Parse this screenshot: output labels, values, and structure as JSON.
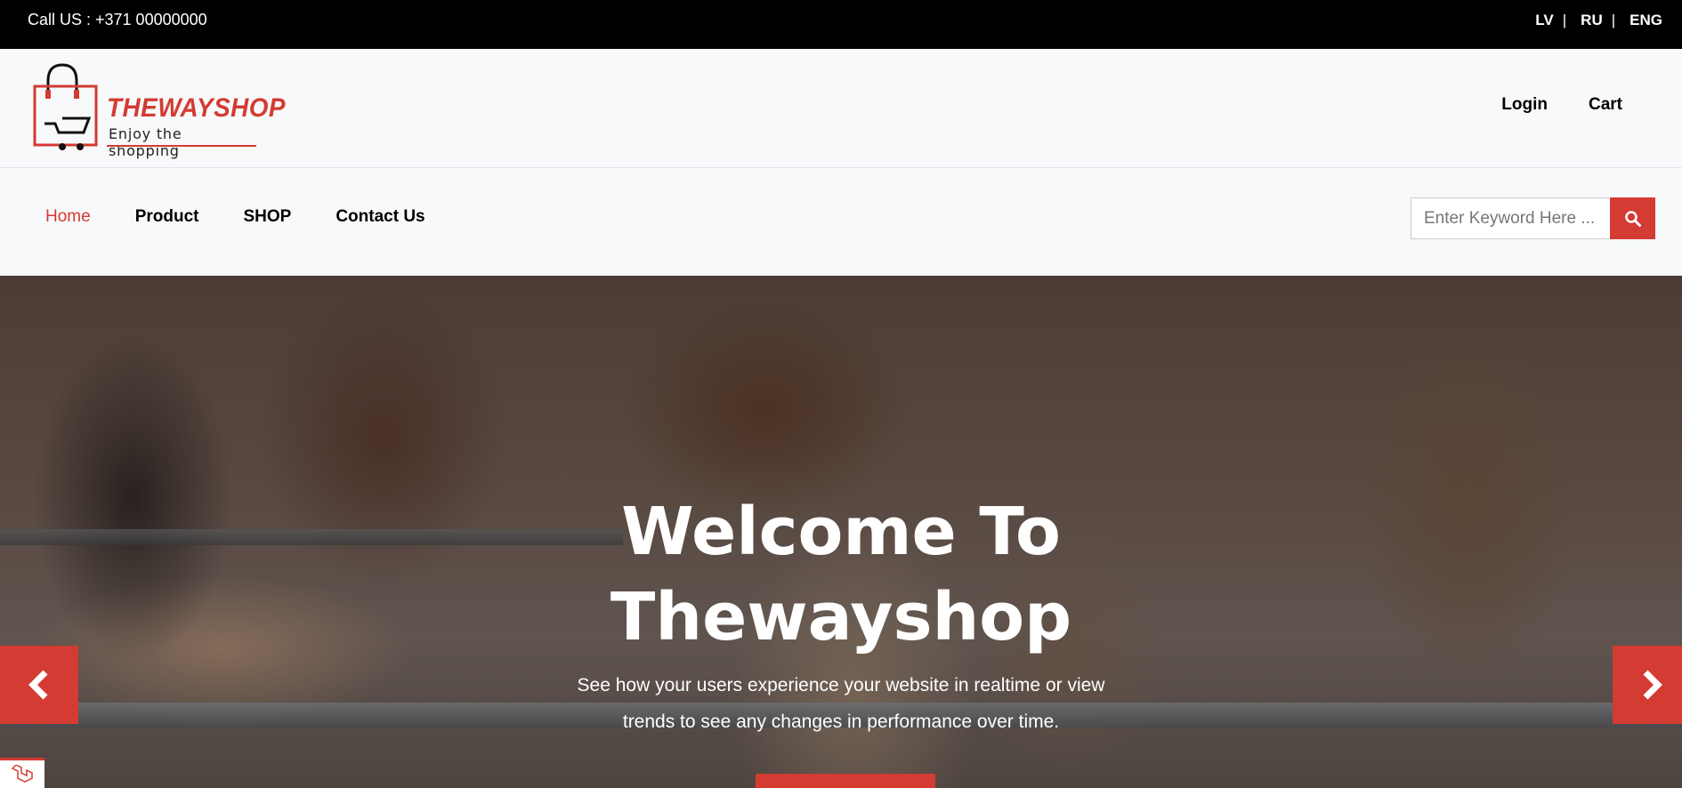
{
  "topbar": {
    "call_text": "Call US : +371 00000000",
    "languages": [
      "LV",
      "RU",
      "ENG"
    ],
    "separator": "|"
  },
  "brand": {
    "name": "THEWAYSHOP",
    "tagline": "Enjoy the shopping",
    "accent_color": "#d33b33"
  },
  "header": {
    "links": [
      "Login",
      "Cart"
    ]
  },
  "nav": {
    "items": [
      "Home",
      "Product",
      "SHOP",
      "Contact Us"
    ],
    "active": "Home"
  },
  "search": {
    "placeholder": "Enter Keyword Here ...",
    "icon": "search-icon"
  },
  "hero": {
    "title_line1": "Welcome To",
    "title_line2": "Thewayshop",
    "subtitle_line1": "See how your users experience your website in realtime or view",
    "subtitle_line2": "trends to see any changes in performance over time.",
    "prev_icon": "chevron-left-icon",
    "next_icon": "chevron-right-icon"
  }
}
